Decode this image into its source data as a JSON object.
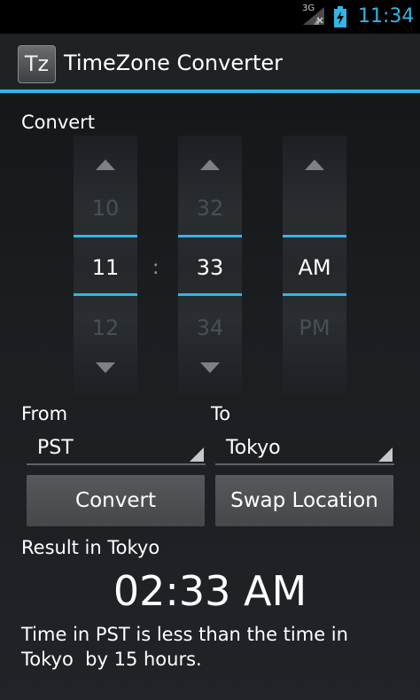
{
  "status_bar": {
    "network": "3G",
    "time": "11:34"
  },
  "action_bar": {
    "icon_text": "Tz",
    "title": "TimeZone Converter"
  },
  "convert_label": "Convert",
  "time_picker": {
    "hour": {
      "prev": "10",
      "current": "11",
      "next": "12"
    },
    "separator": ":",
    "minute": {
      "prev": "32",
      "current": "33",
      "next": "34"
    },
    "ampm": {
      "prev": "",
      "current": "AM",
      "next": "PM"
    }
  },
  "from": {
    "label": "From",
    "value": "PST"
  },
  "to": {
    "label": "To",
    "value": "Tokyo"
  },
  "buttons": {
    "convert": "Convert",
    "swap": "Swap Location"
  },
  "result": {
    "heading": "Result in Tokyo",
    "time": "02:33 AM",
    "description": "Time in PST is less than the time in\nTokyo  by 15 hours."
  },
  "colors": {
    "accent": "#33b5e5",
    "background": "#1b1e21"
  },
  "icons": [
    "signal-3g-icon",
    "battery-charging-icon",
    "app-tz-icon",
    "arrow-up-icon",
    "arrow-down-icon",
    "spinner-dropdown-icon"
  ]
}
